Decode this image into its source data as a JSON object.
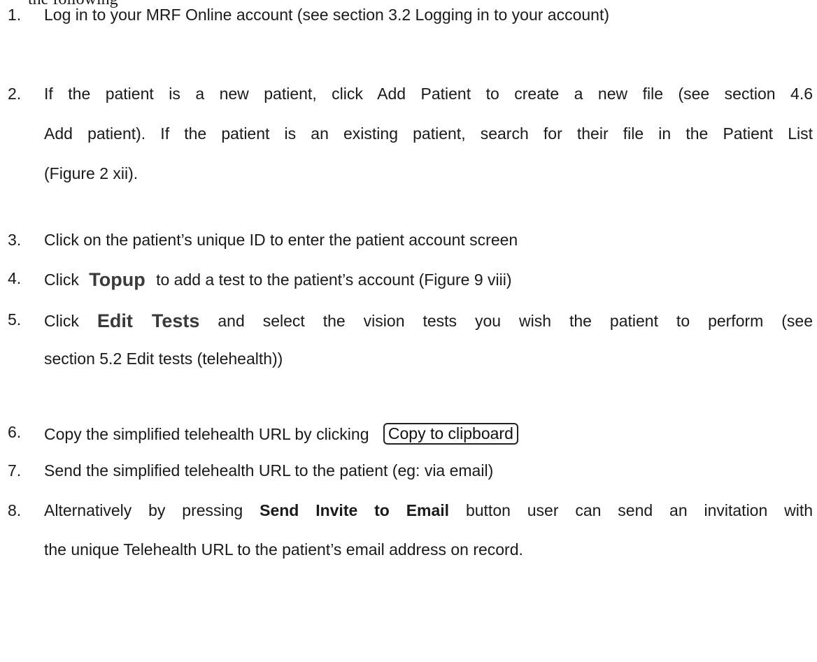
{
  "header_cut": "the following",
  "items": [
    {
      "number": "1.",
      "lines": [
        "Log in to your MRF Online account (see section 3.2 Logging in to your account)"
      ]
    },
    {
      "number": "2.",
      "lines": [
        "If the patient is a new patient, click Add Patient to create a new file (see section 4.6",
        "Add patient). If the patient is an existing patient, search for their file in the Patient List",
        "(Figure 2 xii)."
      ]
    },
    {
      "number": "3.",
      "lines": [
        "Click on the patient’s unique ID to enter the patient account screen"
      ]
    },
    {
      "number": "4.",
      "prefix": "Click",
      "button": "Topup",
      "suffix": "to add a test to the patient’s account (Figure 9 viii)"
    },
    {
      "number": "5.",
      "prefix": "Click",
      "button": "Edit Tests",
      "suffix": "and select the vision tests you wish the patient to perform (see",
      "line2": "section 5.2 Edit tests (telehealth))"
    },
    {
      "number": "6.",
      "text": "Copy the simplified telehealth URL by clicking",
      "button": "Copy to clipboard"
    },
    {
      "number": "7.",
      "lines": [
        "Send the simplified telehealth URL to the patient (eg: via email)"
      ]
    },
    {
      "number": "8.",
      "prefix": "Alternatively by pressing",
      "bold": "Send Invite to Email",
      "suffix": "button user can send an invitation with",
      "line2": "the unique Telehealth URL to the patient’s email address on record."
    }
  ]
}
